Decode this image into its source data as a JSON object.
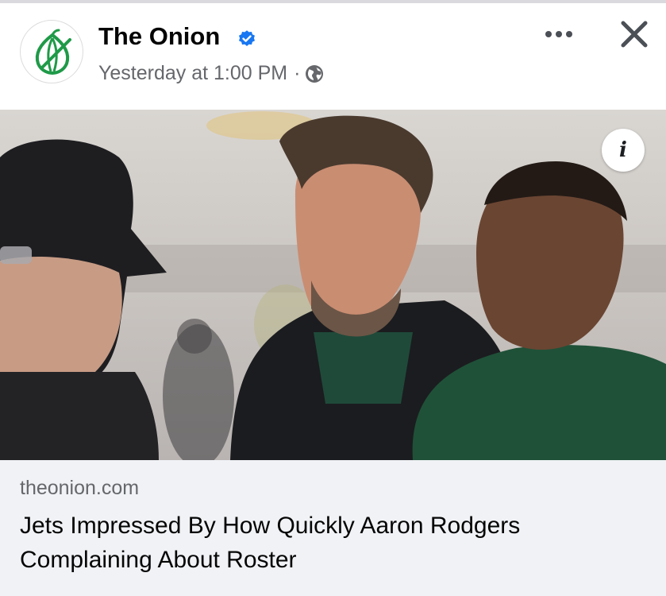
{
  "post": {
    "page_name": "The Onion",
    "timestamp": "Yesterday at 1:00 PM",
    "separator": "·",
    "verified_icon": "verified-badge-icon",
    "audience_icon": "globe-icon"
  },
  "actions": {
    "more_icon": "more-options-icon",
    "close_icon": "close-icon"
  },
  "photo": {
    "info_label": "i"
  },
  "link": {
    "domain": "theonion.com",
    "headline": "Jets Impressed By How Quickly Aaron Rodgers Complaining About Roster"
  },
  "colors": {
    "brand_green": "#1f9a48",
    "verified_blue": "#1877f2",
    "meta_gray": "#65676b",
    "link_box_bg": "#f0f2f5"
  }
}
